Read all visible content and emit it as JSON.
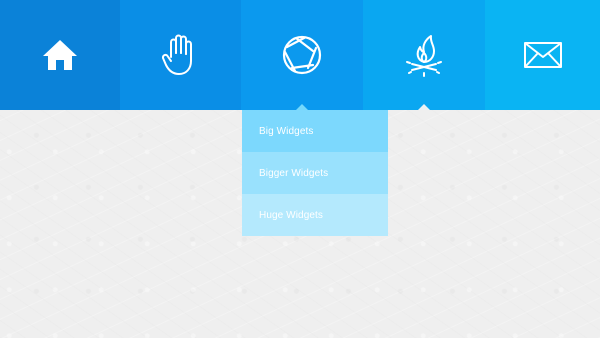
{
  "nav": {
    "items": [
      {
        "icon": "home-icon",
        "color": "#0b82d8"
      },
      {
        "icon": "hand-icon",
        "color": "#0a8ee6"
      },
      {
        "icon": "aperture-icon",
        "color": "#0b99ee",
        "active": true
      },
      {
        "icon": "campfire-icon",
        "color": "#0aa7f1"
      },
      {
        "icon": "mail-icon",
        "color": "#0ab4f3"
      }
    ]
  },
  "dropdown": {
    "items": [
      {
        "label": "Big Widgets",
        "color": "#7cd8fd"
      },
      {
        "label": "Bigger Widgets",
        "color": "#99e1fd"
      },
      {
        "label": "Huge Widgets",
        "color": "#b4e9fd"
      }
    ]
  },
  "colors": {
    "background": "#efefef",
    "icon": "#ffffff"
  }
}
